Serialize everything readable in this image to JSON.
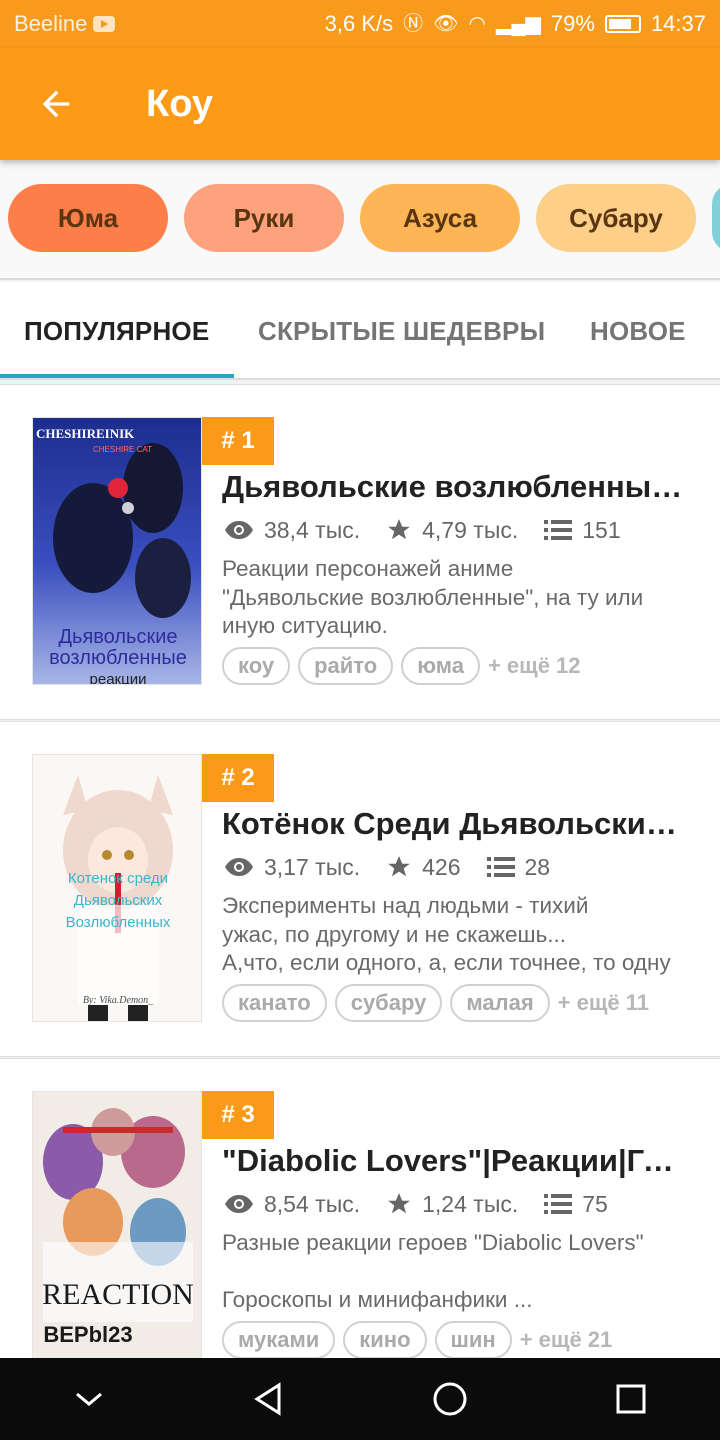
{
  "status_bar": {
    "carrier": "Beeline",
    "speed": "3,6 K/s",
    "battery": "79%",
    "time": "14:37"
  },
  "app_bar": {
    "title": "Коу"
  },
  "chips": [
    {
      "label": "Юма",
      "color": "#fd7e49"
    },
    {
      "label": "Руки",
      "color": "#fda27c"
    },
    {
      "label": "Азуса",
      "color": "#fdb555"
    },
    {
      "label": "Субару",
      "color": "#fdcf88"
    }
  ],
  "tabs": [
    {
      "label": "ПОПУЛЯРНОЕ",
      "active": true
    },
    {
      "label": "СКРЫТЫЕ ШЕДЕВРЫ",
      "active": false
    },
    {
      "label": "НОВОЕ",
      "active": false
    }
  ],
  "stories": [
    {
      "rank": "# 1",
      "title": "Дьявольские возлюбленные: реакции",
      "views": "38,4 тыс.",
      "stars": "4,79 тыс.",
      "parts": "151",
      "desc_lines": [
        "Реакции персонажей аниме",
        "\"Дьявольские возлюбленные\", на ту или",
        "иную ситуацию."
      ],
      "tags": [
        "коу",
        "райто",
        "юма"
      ],
      "more": "+ ещё 12",
      "cover_text": {
        "top": "CHESHIREINIK",
        "sub": "CHESHIRE CAT",
        "main1": "Дьявольские",
        "main2": "возлюбленные",
        "main3": "реакции"
      }
    },
    {
      "rank": "# 2",
      "title": "Котёнок Среди Дьявольских Возлюбленных",
      "views": "3,17 тыс.",
      "stars": "426",
      "parts": "28",
      "desc_lines": [
        "Эксперименты над людьми - тихий",
        "ужас, по другому и не скажешь...",
        "А,что, если одного, а, если точнее, то одну"
      ],
      "tags": [
        "канато",
        "субару",
        "малая"
      ],
      "more": "+ ещё 11",
      "cover_text": {
        "main1": "Котенок среди",
        "main2": "Дьявольских",
        "main3": "Возлюбленных",
        "sign": "By: Vika.Demon_"
      }
    },
    {
      "rank": "# 3",
      "title": "\"Diabolic Lovers\"|Реакции|Гороскопы",
      "views": "8,54 тыс.",
      "stars": "1,24 тыс.",
      "parts": "75",
      "desc_lines": [
        "Разные реакции героев \"Diabolic Lovers\"",
        "",
        "Гороскопы и минифанфики ..."
      ],
      "tags": [
        "муками",
        "кино",
        "шин"
      ],
      "more": "+ ещё 21",
      "cover_text": {
        "main1": "REACTION",
        "main2": "BEPbl23"
      }
    }
  ]
}
